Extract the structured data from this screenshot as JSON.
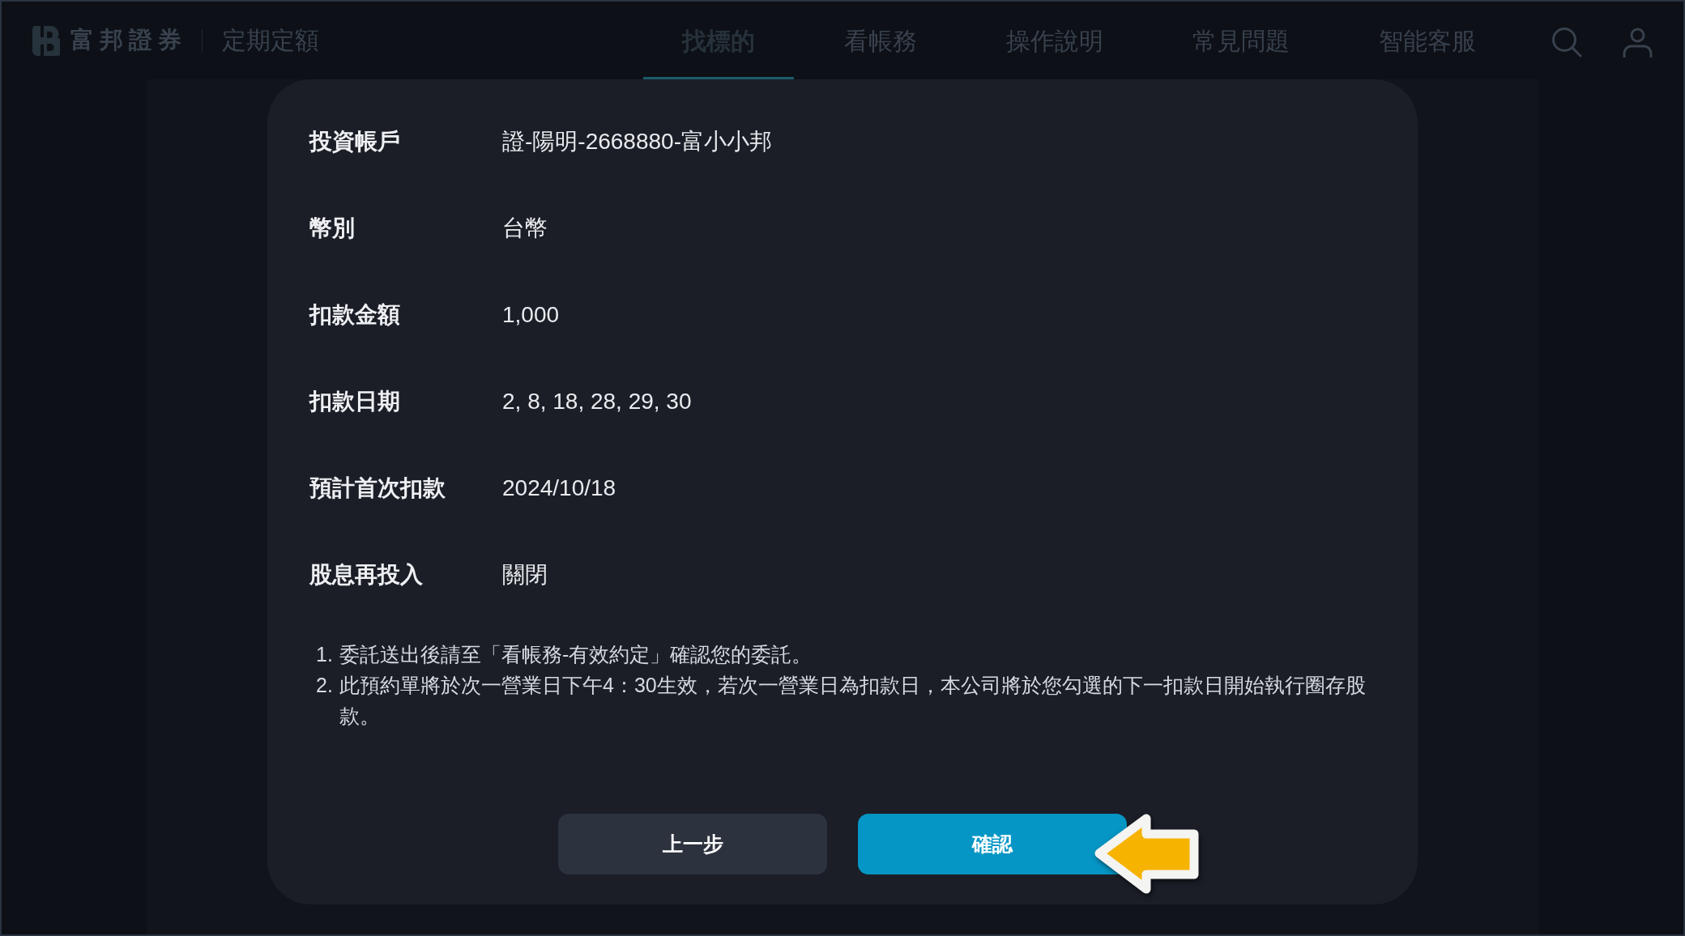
{
  "header": {
    "brand": "富邦證券",
    "product": "定期定額",
    "nav": [
      {
        "label": "找標的",
        "selected": true
      },
      {
        "label": "看帳務",
        "selected": false
      },
      {
        "label": "操作說明",
        "selected": false
      },
      {
        "label": "常見問題",
        "selected": false
      },
      {
        "label": "智能客服",
        "selected": false
      }
    ]
  },
  "dialog": {
    "fields": [
      {
        "label": "投資帳戶",
        "value": "證-陽明-2668880-富小小邦"
      },
      {
        "label": "幣別",
        "value": "台幣"
      },
      {
        "label": "扣款金額",
        "value": "1,000"
      },
      {
        "label": "扣款日期",
        "value": "2, 8, 18, 28, 29, 30"
      },
      {
        "label": "預計首次扣款",
        "value": "2024/10/18"
      },
      {
        "label": "股息再投入",
        "value": "關閉"
      }
    ],
    "notes": [
      {
        "number": "1.",
        "text": "委託送出後請至「看帳務-有效約定」確認您的委託。"
      },
      {
        "number": "2.",
        "text": "此預約單將於次一營業日下午4：30生效，若次一營業日為扣款日，本公司將於您勾選的下一扣款日開始執行圈存股款。"
      }
    ],
    "buttons": [
      {
        "label": "上一步",
        "kind": "secondary"
      },
      {
        "label": "確認",
        "kind": "primary"
      }
    ]
  }
}
